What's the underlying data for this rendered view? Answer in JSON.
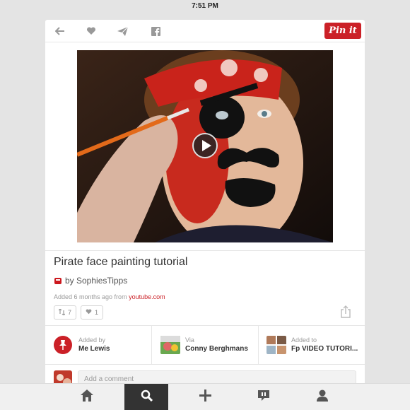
{
  "status_bar": {
    "time": "7:51 PM"
  },
  "toolbar": {
    "back_icon": "arrow-left-icon",
    "like_icon": "heart-icon",
    "send_icon": "paper-plane-icon",
    "facebook_icon": "facebook-icon",
    "pin_it_label": "Pin it",
    "pin_color": "#cb2027"
  },
  "pin": {
    "title": "Pirate face painting tutorial",
    "by_label": "by SophiesTipps",
    "added_prefix": "Added 6 months ago from",
    "source_domain": "youtube.com",
    "repins": "7",
    "likes": "1"
  },
  "meta": {
    "added_by_label": "Added by",
    "added_by_name": "Me Lewis",
    "via_label": "Via",
    "via_name": "Conny Berghmans",
    "added_to_label": "Added to",
    "board_name": "Fp  VIDEO TUTORI..."
  },
  "comment": {
    "placeholder": "Add a comment"
  },
  "tabbar": {
    "items": [
      {
        "icon": "home-icon"
      },
      {
        "icon": "search-icon",
        "active": true
      },
      {
        "icon": "plus-icon"
      },
      {
        "icon": "news-icon"
      },
      {
        "icon": "profile-icon"
      }
    ]
  }
}
